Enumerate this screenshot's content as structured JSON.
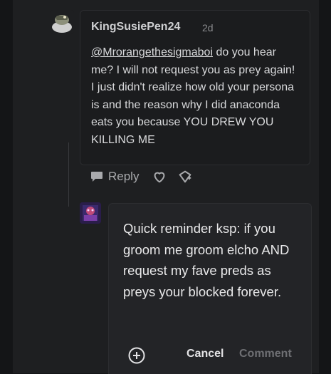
{
  "comment": {
    "username": "KingSusiePen24",
    "time": "2d",
    "mention": "@Mrorangethesigmaboi",
    "body": " do you hear me? I will not request you as prey again! I just didn't realize how old your persona is and the reason why I did anaconda eats you because YOU DREW YOU KILLING ME",
    "actions": {
      "reply_label": "Reply",
      "reply_icon": "chat-bubble-icon",
      "like_icon": "heart-icon",
      "gift_icon": "gift-icon"
    }
  },
  "reply_editor": {
    "text": "Quick reminder ksp: if you groom me groom elcho AND request my fave preds as preys your blocked forever.",
    "add_icon": "plus-circle-icon",
    "cancel_label": "Cancel",
    "comment_label": "Comment"
  },
  "colors": {
    "background": "#141517",
    "panel": "#1e1f21",
    "text": "#d8d9db",
    "muted": "#8a8b8e",
    "disabled_button": "#6e6f73"
  }
}
